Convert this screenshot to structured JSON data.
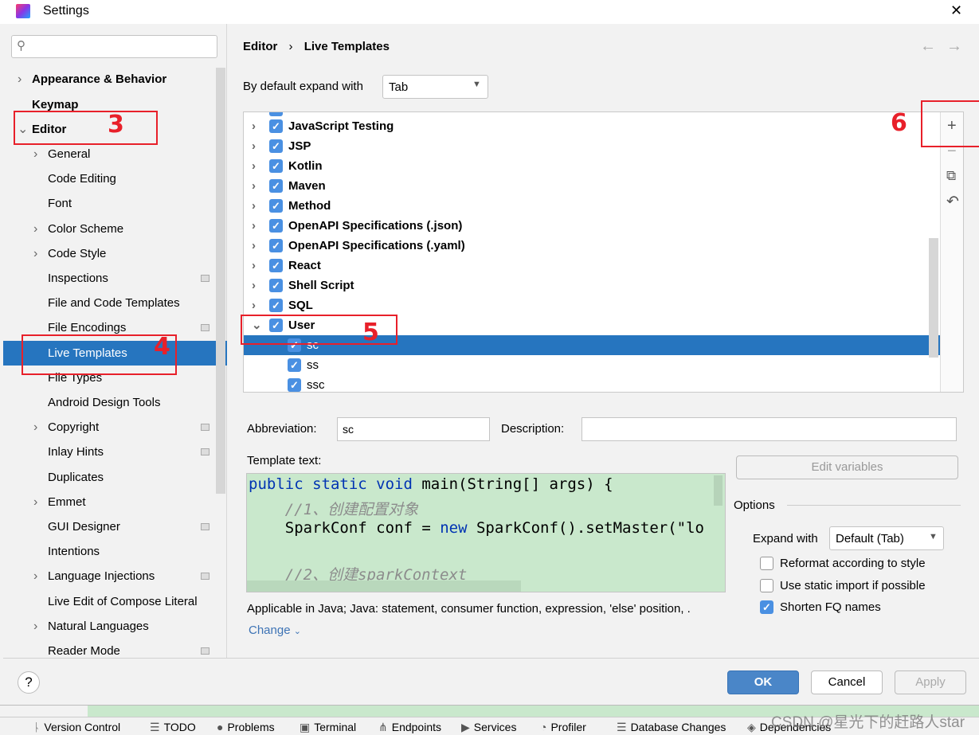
{
  "window": {
    "title": "Settings",
    "close": "✕"
  },
  "search": {
    "placeholder": ""
  },
  "sidebar": {
    "items": [
      {
        "label": "Appearance & Behavior",
        "bold": true,
        "chevron": "›"
      },
      {
        "label": "Keymap",
        "bold": true
      },
      {
        "label": "Editor",
        "bold": true,
        "chevron": "⌄"
      },
      {
        "label": "General",
        "chevron": "›"
      },
      {
        "label": "Code Editing"
      },
      {
        "label": "Font"
      },
      {
        "label": "Color Scheme",
        "chevron": "›"
      },
      {
        "label": "Code Style",
        "chevron": "›"
      },
      {
        "label": "Inspections",
        "badge": true
      },
      {
        "label": "File and Code Templates"
      },
      {
        "label": "File Encodings",
        "badge": true
      },
      {
        "label": "Live Templates",
        "selected": true
      },
      {
        "label": "File Types"
      },
      {
        "label": "Android Design Tools"
      },
      {
        "label": "Copyright",
        "chevron": "›",
        "badge": true
      },
      {
        "label": "Inlay Hints",
        "badge": true
      },
      {
        "label": "Duplicates"
      },
      {
        "label": "Emmet",
        "chevron": "›"
      },
      {
        "label": "GUI Designer",
        "badge": true
      },
      {
        "label": "Intentions"
      },
      {
        "label": "Language Injections",
        "chevron": "›",
        "badge": true
      },
      {
        "label": "Live Edit of Compose Literal"
      },
      {
        "label": "Natural Languages",
        "chevron": "›"
      },
      {
        "label": "Reader Mode",
        "badge": true
      }
    ]
  },
  "breadcrumb": {
    "parent": "Editor",
    "separator": "›",
    "current": "Live Templates",
    "back": "←",
    "forward": "→"
  },
  "expand": {
    "label": "By default expand with",
    "value": "Tab"
  },
  "templates": [
    {
      "label": "JavaScript Testing",
      "group": true,
      "checked": true
    },
    {
      "label": "JSP",
      "group": true,
      "checked": true
    },
    {
      "label": "Kotlin",
      "group": true,
      "checked": true
    },
    {
      "label": "Maven",
      "group": true,
      "checked": true
    },
    {
      "label": "Method",
      "group": true,
      "checked": true
    },
    {
      "label": "OpenAPI Specifications (.json)",
      "group": true,
      "checked": true
    },
    {
      "label": "OpenAPI Specifications (.yaml)",
      "group": true,
      "checked": true
    },
    {
      "label": "React",
      "group": true,
      "checked": true
    },
    {
      "label": "Shell Script",
      "group": true,
      "checked": true
    },
    {
      "label": "SQL",
      "group": true,
      "checked": true
    },
    {
      "label": "User",
      "group": true,
      "checked": true,
      "expanded": true
    },
    {
      "label": "sc",
      "checked": true,
      "selected": true
    },
    {
      "label": "ss",
      "checked": true
    },
    {
      "label": "ssc",
      "checked": true
    }
  ],
  "toolbar": {
    "add": "+",
    "remove": "−",
    "copy": "⧉",
    "restore": "↶"
  },
  "editor": {
    "abbreviation_label": "Abbreviation:",
    "abbreviation": "sc",
    "description_label": "Description:",
    "description": "",
    "template_label": "Template text:",
    "code": [
      [
        [
          "kw",
          "public static void "
        ],
        [
          "",
          "main(String[] args) {"
        ]
      ],
      [
        [
          "cm",
          "    //1、创建配置对象"
        ]
      ],
      [
        [
          "",
          "    SparkConf conf = "
        ],
        [
          "kw",
          "new "
        ],
        [
          "",
          "SparkConf().setMaster(\"lo"
        ]
      ],
      [
        [
          "",
          ""
        ]
      ],
      [
        [
          "cm",
          "    //2、创建sparkContext"
        ]
      ]
    ],
    "applicable": "Applicable in Java; Java: statement, consumer function, expression, 'else' position, .",
    "change": "Change",
    "edit_variables": "Edit variables"
  },
  "options": {
    "title": "Options",
    "expand_label": "Expand with",
    "expand_value": "Default (Tab)",
    "reformat": {
      "label": "Reformat according to style",
      "checked": false
    },
    "static_import": {
      "label": "Use static import if possible",
      "checked": false
    },
    "shorten": {
      "label": "Shorten FQ names",
      "checked": true
    }
  },
  "buttons": {
    "help": "?",
    "ok": "OK",
    "cancel": "Cancel",
    "apply": "Apply"
  },
  "annotations": [
    "3",
    "4",
    "5",
    "6"
  ],
  "toolwindows": [
    "Version Control",
    "TODO",
    "Problems",
    "Terminal",
    "Endpoints",
    "Services",
    "Profiler",
    "Database Changes",
    "Dependencies"
  ],
  "watermark": "CSDN @星光下的赶路人star",
  "colors": {
    "accent": "#2675bf",
    "ok": "#4a86c8",
    "annotation": "#e8202a",
    "code_bg": "#c9e8cc"
  }
}
